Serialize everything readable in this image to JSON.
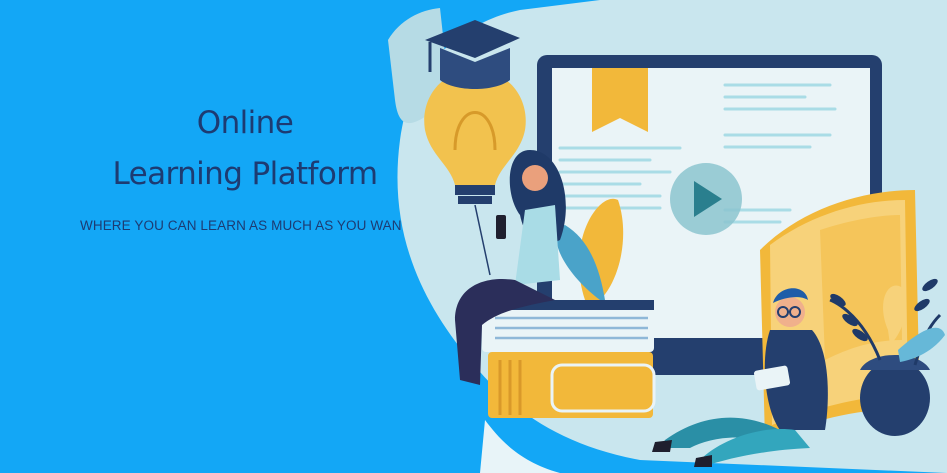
{
  "hero": {
    "title_line1": "Online",
    "title_line2": "Learning Platform",
    "subtitle": "WHERE YOU CAN LEARN AS MUCH AS YOU WANT"
  },
  "colors": {
    "background": "#13a7f6",
    "title_text": "#1d3b72",
    "navy": "#1f3a68",
    "gold": "#f2b83a",
    "teal_light": "#a9dce6"
  },
  "icons": {
    "graduation_cap": "graduation-cap-icon",
    "lightbulb": "lightbulb-icon",
    "play_button": "play-icon",
    "plant": "plant-icon"
  }
}
